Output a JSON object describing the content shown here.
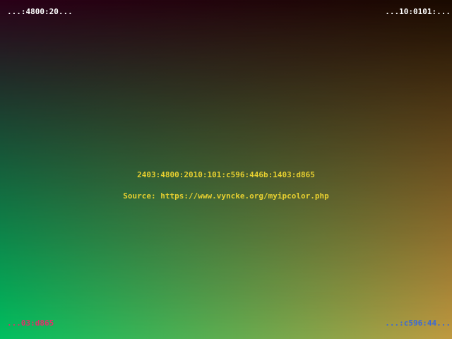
{
  "corners": {
    "top_left": "...:4800:20...",
    "top_right": "...10:0101:...",
    "bottom_left": "...03:d865",
    "bottom_right": "...:c596:44..."
  },
  "center": {
    "ip_address": "2403:4800:2010:101:c596:446b:1403:d865",
    "source": "Source: https://www.vyncke.org/myipcolor.php"
  },
  "colors": {
    "top_left_bg": "#2a0018",
    "top_right_bg": "#1a0a00",
    "bottom_left_bg": "#00c060",
    "bottom_right_bg": "#c09a40",
    "top_left_text": "#ffffff",
    "top_right_text": "#ffffff",
    "bottom_left_text": "#e0306a",
    "bottom_right_text": "#3a6ad8",
    "center_text": "#e8d030"
  }
}
